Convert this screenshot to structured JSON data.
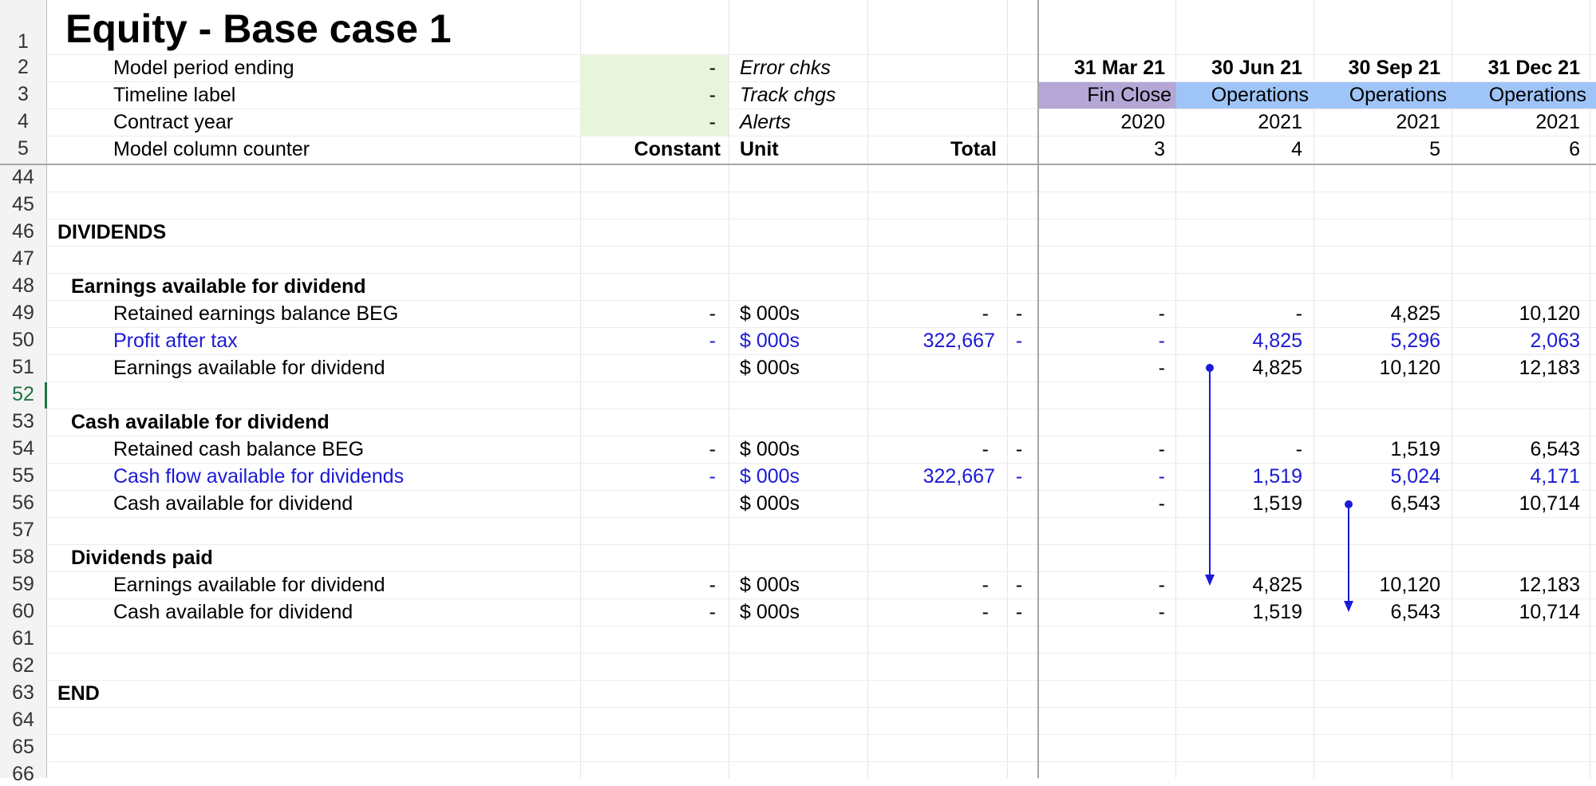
{
  "sheet": {
    "title": "Equity - Base case 1",
    "header_rows": {
      "row2": {
        "num": "2",
        "label": "Model period ending",
        "input": "-",
        "note": "Error chks"
      },
      "row3": {
        "num": "3",
        "label": "Timeline label",
        "input": "-",
        "note": "Track chgs"
      },
      "row4": {
        "num": "4",
        "label": "Contract year",
        "input": "-",
        "note": "Alerts"
      },
      "row5": {
        "num": "5",
        "label": "Model column counter",
        "constant": "Constant",
        "unit": "Unit",
        "total": "Total"
      }
    },
    "periods": [
      {
        "date": "31 Mar 21",
        "label": "Fin Close",
        "year": "2020",
        "counter": "3"
      },
      {
        "date": "30 Jun 21",
        "label": "Operations",
        "year": "2021",
        "counter": "4"
      },
      {
        "date": "30 Sep 21",
        "label": "Operations",
        "year": "2021",
        "counter": "5"
      },
      {
        "date": "31 Dec 21",
        "label": "Operations",
        "year": "2021",
        "counter": "6"
      }
    ],
    "rows": {
      "r1": "1",
      "r44": "44",
      "r45": "45",
      "r46": {
        "num": "46",
        "text": "DIVIDENDS"
      },
      "r47": "47",
      "r48": {
        "num": "48",
        "text": "Earnings available for dividend"
      },
      "r49": {
        "num": "49",
        "label": "Retained earnings balance BEG",
        "constant": "-",
        "unit": "$ 000s",
        "total": "-",
        "flag": "-",
        "v": [
          "-",
          "-",
          "4,825",
          "10,120"
        ]
      },
      "r50": {
        "num": "50",
        "label": "Profit after tax",
        "constant": "-",
        "unit": "$ 000s",
        "total": "322,667",
        "flag": "-",
        "v": [
          "-",
          "4,825",
          "5,296",
          "2,063"
        ]
      },
      "r51": {
        "num": "51",
        "label": "Earnings available for dividend",
        "unit": "$ 000s",
        "v": [
          "-",
          "4,825",
          "10,120",
          "12,183"
        ]
      },
      "r52": "52",
      "r53": {
        "num": "53",
        "text": "Cash available for dividend"
      },
      "r54": {
        "num": "54",
        "label": "Retained cash balance BEG",
        "constant": "-",
        "unit": "$ 000s",
        "total": "-",
        "flag": "-",
        "v": [
          "-",
          "-",
          "1,519",
          "6,543"
        ]
      },
      "r55": {
        "num": "55",
        "label": "Cash flow available for dividends",
        "constant": "-",
        "unit": "$ 000s",
        "total": "322,667",
        "flag": "-",
        "v": [
          "-",
          "1,519",
          "5,024",
          "4,171"
        ]
      },
      "r56": {
        "num": "56",
        "label": "Cash available for dividend",
        "unit": "$ 000s",
        "v": [
          "-",
          "1,519",
          "6,543",
          "10,714"
        ]
      },
      "r57": "57",
      "r58": {
        "num": "58",
        "text": "Dividends paid"
      },
      "r59": {
        "num": "59",
        "label": "Earnings available for dividend",
        "constant": "-",
        "unit": "$ 000s",
        "total": "-",
        "flag": "-",
        "v": [
          "-",
          "4,825",
          "10,120",
          "12,183"
        ]
      },
      "r60": {
        "num": "60",
        "label": "Cash available for dividend",
        "constant": "-",
        "unit": "$ 000s",
        "total": "-",
        "flag": "-",
        "v": [
          "-",
          "1,519",
          "6,543",
          "10,714"
        ]
      },
      "r61": "61",
      "r62": "62",
      "r63": {
        "num": "63",
        "text": "END"
      },
      "r64": "64",
      "r65": "65",
      "r66": "66"
    }
  },
  "colors": {
    "input_fill": "#e8f5dc",
    "fin_close_fill": "#b4a7d6",
    "operations_fill": "#9fc5f8",
    "link_blue": "#1a1ad6",
    "selected_row": "#217346"
  }
}
